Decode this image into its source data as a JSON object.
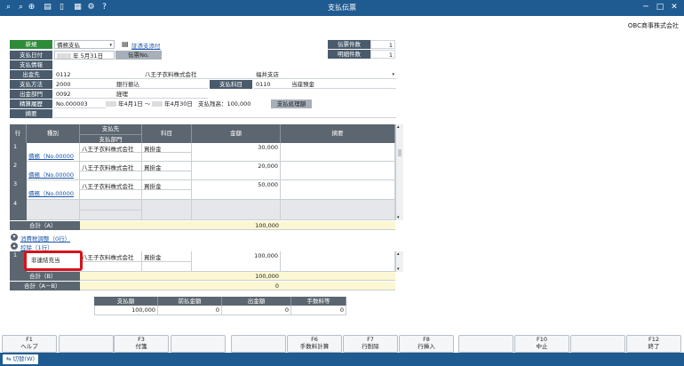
{
  "window": {
    "title": "支払伝票",
    "company": "OBC商事株式会社"
  },
  "header": {
    "mode_label": "新規",
    "voucher_type": "債務支払",
    "evidence_label": "証憑支添付",
    "date_label": "支払日付",
    "date_year_suffix": "年",
    "date_value": "5月31日",
    "voucher_no_label": "伝票No.",
    "pay_info_label": "支払情報",
    "payee_label": "出金先",
    "payee_code": "0112",
    "payee_name": "八王子衣料株式会社",
    "branch_name": "福井支店",
    "method_label": "支払方法",
    "method_code": "2000",
    "method_name": "銀行振込",
    "account_label": "支払科目",
    "account_code": "0110",
    "account_name": "当座預金",
    "dept_label": "出金部門",
    "dept_code": "0092",
    "dept_name": "経理",
    "settle_label": "精算履歴",
    "settle_no": "No.000003",
    "settle_from": "年4月1日 ～",
    "settle_to": "年4月30日",
    "settle_balance": "支払残高：100,000",
    "settle_btn": "支払処理額",
    "memo_label": "摘要",
    "count_label": "伝票件数",
    "count_value": "1",
    "detail_label": "明細件数",
    "detail_value": "1"
  },
  "grid": {
    "headers": {
      "row": "行",
      "type": "種別",
      "payee_top": "支払先",
      "payee_bottom": "支払部門",
      "subject": "科目",
      "amount": "金額",
      "memo": "摘要"
    },
    "rows": [
      {
        "num": "1",
        "type": "債務（No.00000",
        "payee": "八王子衣料株式会社",
        "subject": "買掛金",
        "amount": "30,000"
      },
      {
        "num": "2",
        "type": "債務（No.00000",
        "payee": "八王子衣料株式会社",
        "subject": "買掛金",
        "amount": "20,000"
      },
      {
        "num": "3",
        "type": "債務（No.00000",
        "payee": "八王子衣料株式会社",
        "subject": "買掛金",
        "amount": "50,000"
      },
      {
        "num": "4",
        "type": "",
        "payee": "",
        "subject": "",
        "amount": ""
      }
    ],
    "total_a_label": "合計（A）",
    "total_a": "100,000",
    "tax_label": "消費税調整（0行）",
    "offset_label": "控除（1行）",
    "offset_row": {
      "num": "1",
      "type": "非連結充当",
      "payee": "八王子衣料株式会社",
      "subject": "買掛金",
      "amount": "100,000"
    },
    "total_b_label": "合計（B）",
    "total_b": "100,000",
    "total_ab_label": "合計（A－B）",
    "total_ab": "0"
  },
  "summary": {
    "headers": [
      "支払額",
      "前払金額",
      "出金額",
      "手数料等"
    ],
    "values": [
      "100,000",
      "0",
      "0",
      "0"
    ]
  },
  "fkeys": [
    {
      "key": "F1",
      "name": "ヘルプ"
    },
    {
      "key": "",
      "name": ""
    },
    {
      "key": "F3",
      "name": "付箋"
    },
    {
      "key": "",
      "name": ""
    },
    {
      "key": "",
      "name": ""
    },
    {
      "key": "F6",
      "name": "手数料計算"
    },
    {
      "key": "F7",
      "name": "行削除"
    },
    {
      "key": "F8",
      "name": "行挿入"
    },
    {
      "key": "",
      "name": ""
    },
    {
      "key": "F10",
      "name": "中止"
    },
    {
      "key": "",
      "name": ""
    },
    {
      "key": "F12",
      "name": "終了"
    }
  ],
  "statusbar": {
    "switch_label": "切替(W)"
  }
}
